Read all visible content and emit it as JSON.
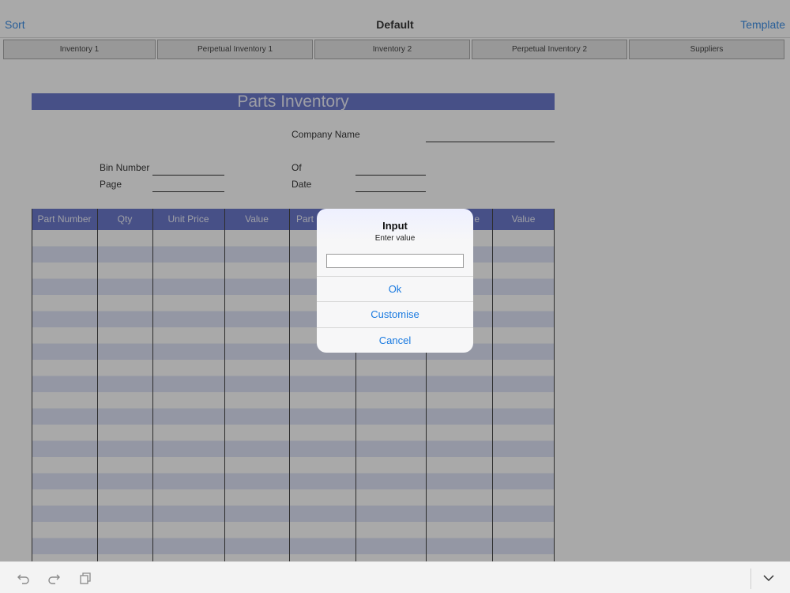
{
  "header": {
    "left": "Sort",
    "title": "Default",
    "right": "Template"
  },
  "tabs": [
    {
      "label": "Inventory 1"
    },
    {
      "label": "Perpetual Inventory 1"
    },
    {
      "label": "Inventory 2"
    },
    {
      "label": "Perpetual Inventory 2"
    },
    {
      "label": "Suppliers"
    }
  ],
  "sheet": {
    "title": "Parts Inventory",
    "company_name_label": "Company Name",
    "bin_number_label": "Bin Number",
    "page_label": "Page",
    "of_label": "Of",
    "date_label": "Date",
    "columns": [
      "Part Number",
      "Qty",
      "Unit Price",
      "Value",
      "Part",
      "",
      "e",
      "Value"
    ]
  },
  "dialog": {
    "title": "Input",
    "message": "Enter value",
    "input_value": "",
    "ok": "Ok",
    "customise": "Customise",
    "cancel": "Cancel"
  },
  "colors": {
    "accent": "#1a7ae0",
    "header_fill": "#5160c2",
    "stripe": "#dadff7"
  },
  "bottombar": {
    "icons": [
      "undo-icon",
      "redo-icon",
      "copy-icon",
      "chevron-down-icon"
    ]
  }
}
